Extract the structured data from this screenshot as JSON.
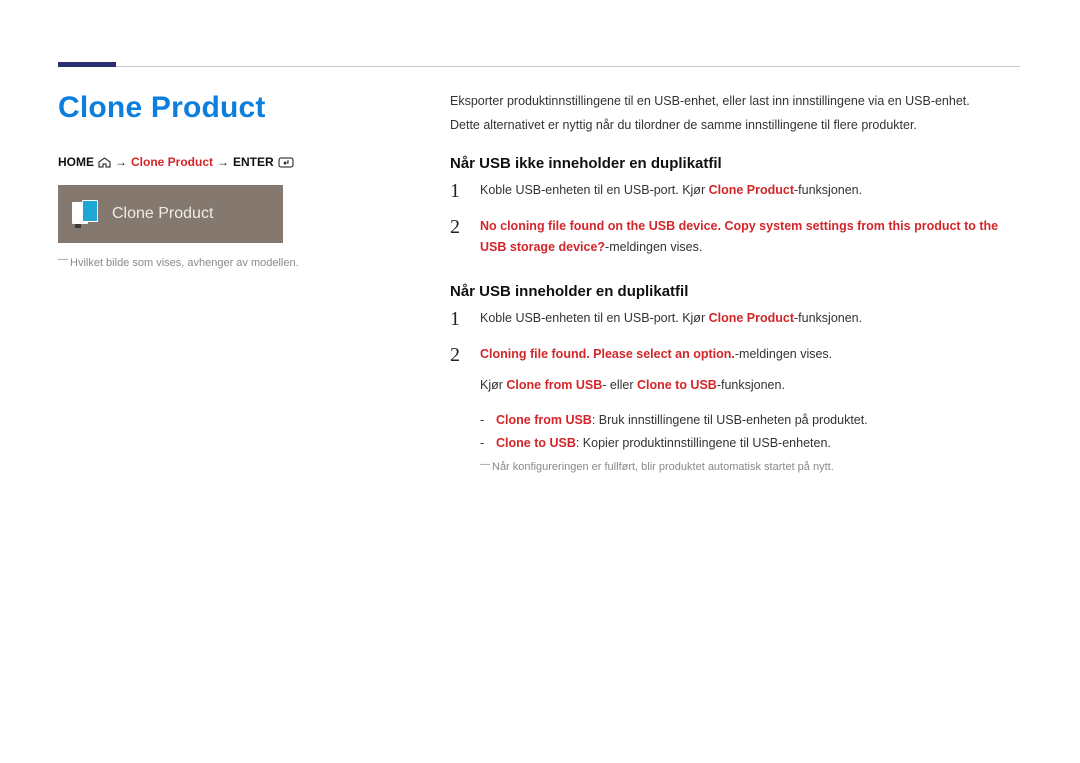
{
  "title": "Clone Product",
  "breadcrumb": {
    "home": "HOME",
    "clone": "Clone Product",
    "enter": "ENTER"
  },
  "chip": {
    "label": "Clone Product"
  },
  "left_footnote": "Hvilket bilde som vises, avhenger av modellen.",
  "intro": {
    "p1": "Eksporter produktinnstillingene til en USB-enhet, eller last inn innstillingene via en USB-enhet.",
    "p2": "Dette alternativet er nyttig når du tilordner de samme innstillingene til flere produkter."
  },
  "sectionA": {
    "heading": "Når USB ikke inneholder en duplikatfil",
    "step1_a": "Koble USB-enheten til en USB-port. Kjør ",
    "step1_b": "Clone Product",
    "step1_c": "-funksjonen.",
    "step2_a": "No cloning file found on the USB device. Copy system settings from this product to the USB storage device?",
    "step2_b": "-meldingen vises."
  },
  "sectionB": {
    "heading": "Når USB inneholder en duplikatfil",
    "step1_a": "Koble USB-enheten til en USB-port. Kjør ",
    "step1_b": "Clone Product",
    "step1_c": "-funksjonen.",
    "step2_a": "Cloning file found. Please select an option.",
    "step2_b": "-meldingen vises.",
    "step3_a": "Kjør ",
    "step3_b": "Clone from USB",
    "step3_c": "- eller ",
    "step3_d": "Clone to USB",
    "step3_e": "-funksjonen.",
    "sub1_a": "Clone from USB",
    "sub1_b": ": Bruk innstillingene til USB-enheten på produktet.",
    "sub2_a": "Clone to USB",
    "sub2_b": ": Kopier produktinnstillingene til USB-enheten.",
    "note": "Når konfigureringen er fullført, blir produktet automatisk startet på nytt."
  }
}
